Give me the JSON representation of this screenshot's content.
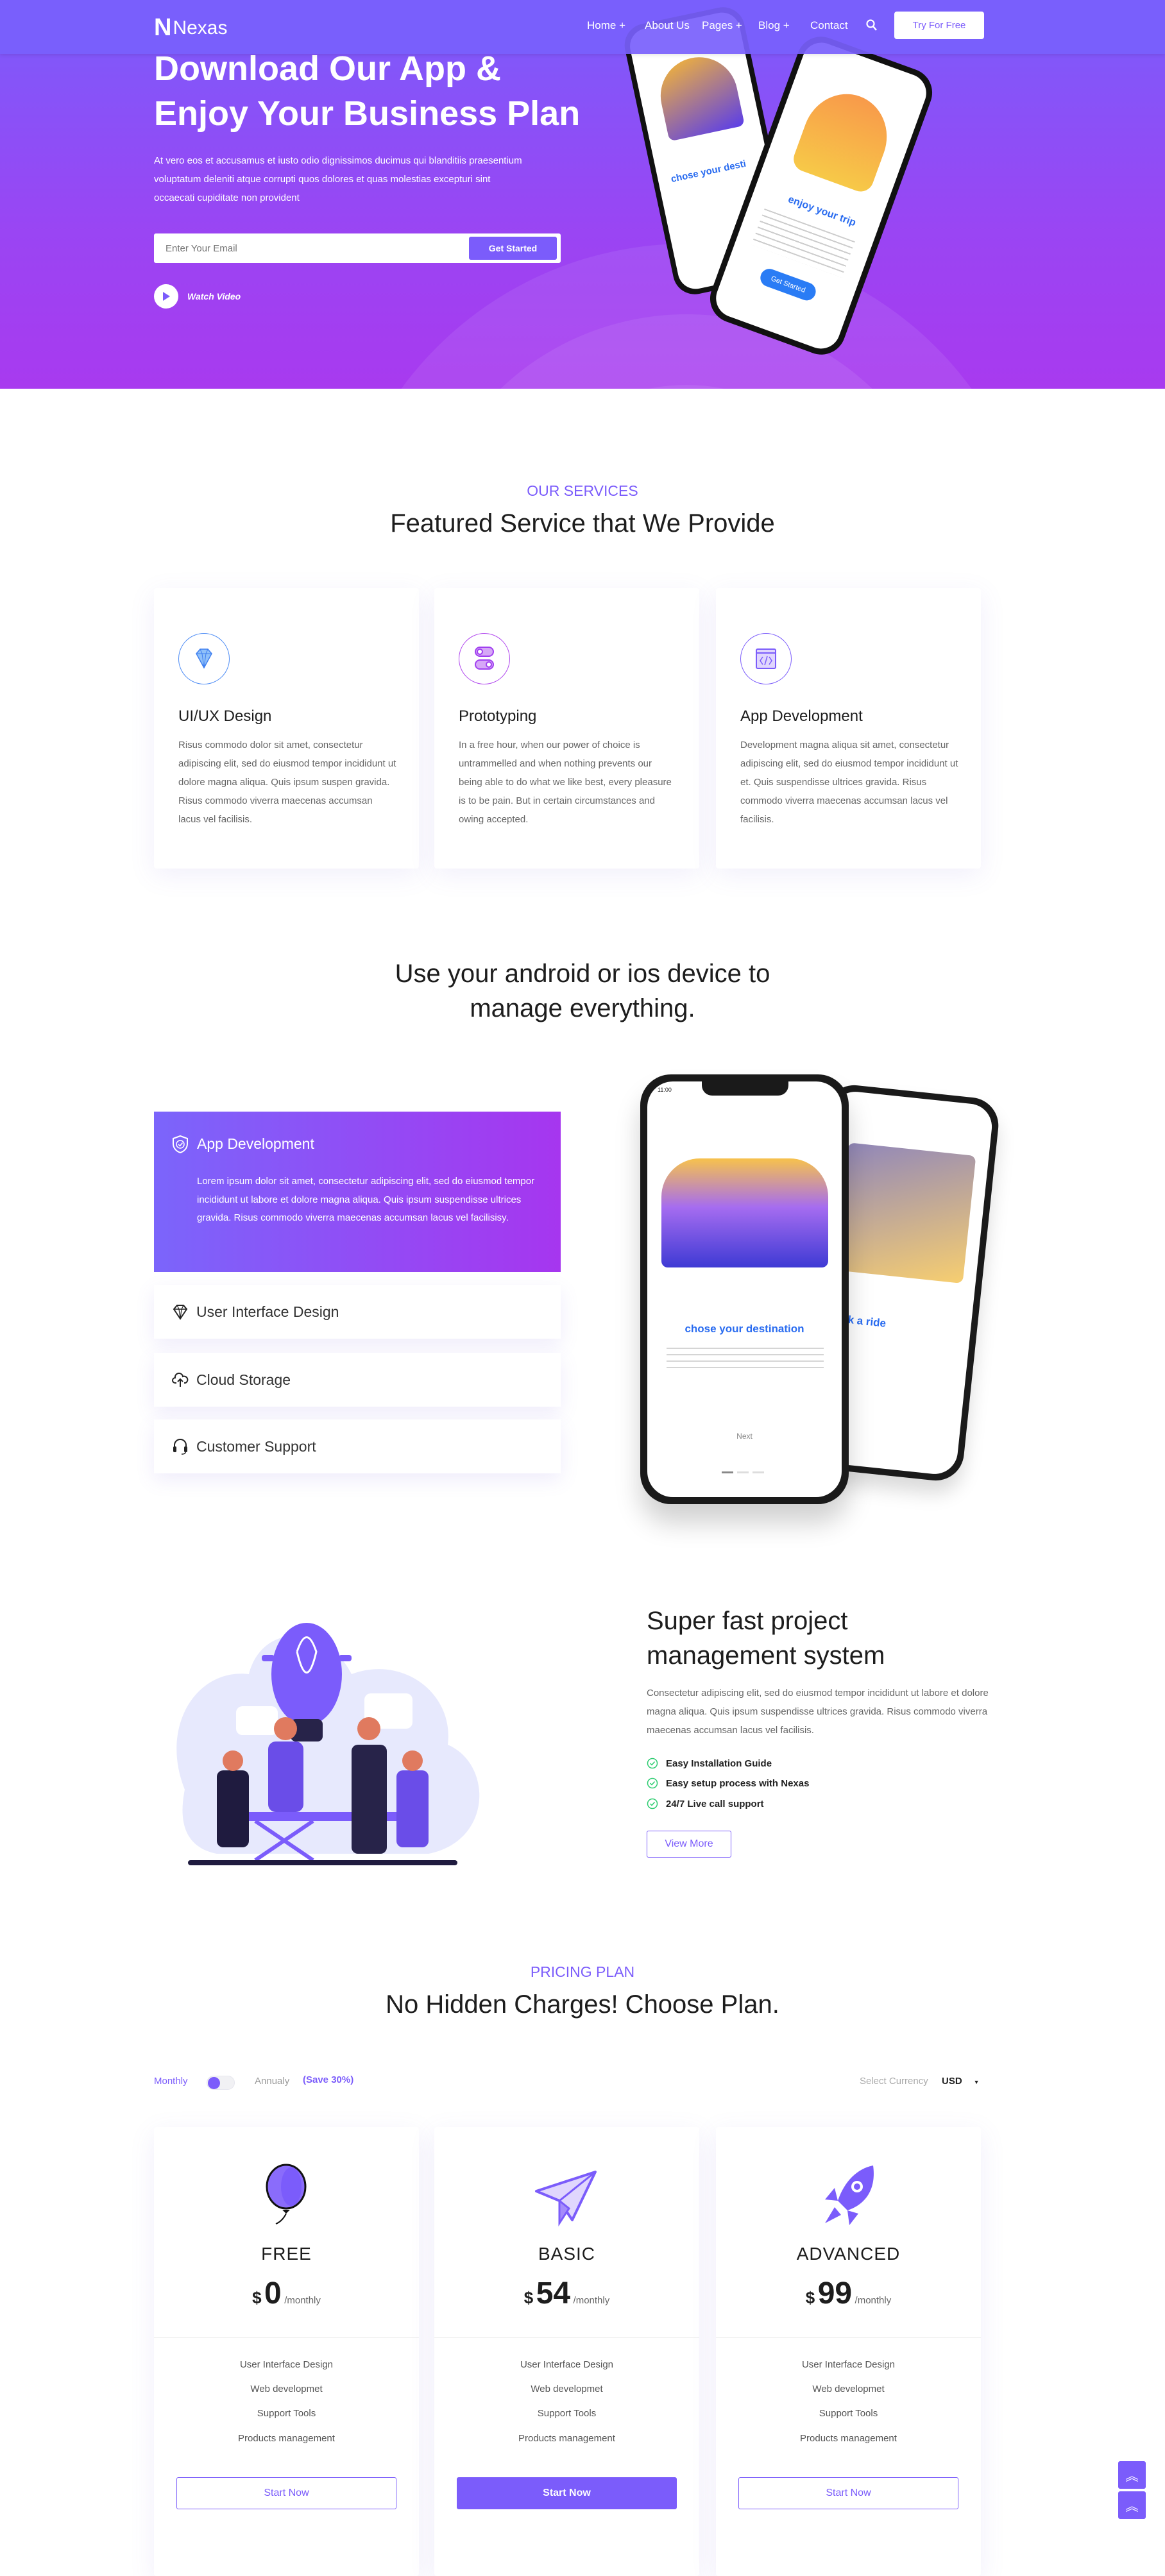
{
  "nav": {
    "brand": "Nexas",
    "brand_letter": "N",
    "items": [
      {
        "label": "Home +"
      },
      {
        "label": "About Us"
      },
      {
        "label": "Pages +"
      },
      {
        "label": "Blog +"
      },
      {
        "label": "Contact"
      }
    ],
    "search_icon": "search-icon",
    "cta": "Try For Free"
  },
  "hero": {
    "title_line1": "Download Our App &",
    "title_line2": "Enjoy Your Business Plan",
    "paragraph": "At vero eos et accusamus et iusto odio dignissimos ducimus qui blanditiis praesentium voluptatum deleniti atque corrupti quos dolores et quas molestias excepturi sint occaecati cupiditate non provident",
    "email_placeholder": "Enter Your Email",
    "submit": "Get Started",
    "watch_video": "Watch Video",
    "phone_back_text": "chose your desti",
    "phone_front_text": "enjoy your trip",
    "phone_front_button": "Get Started"
  },
  "services": {
    "eyebrow": "OUR SERVICES",
    "title": "Featured Service that We Provide",
    "cards": [
      {
        "icon": "diamond-icon",
        "title": "UI/UX Design",
        "text": "Risus commodo dolor sit amet, consectetur adipiscing elit, sed do eiusmod tempor incididunt ut dolore magna aliqua. Quis ipsum suspen gravida. Risus commodo viverra maecenas accumsan lacus vel facilisis."
      },
      {
        "icon": "toggle-switches-icon",
        "title": "Prototyping",
        "text": "In a free hour, when our power of choice is untrammelled and when nothing prevents our being able to do what we like best, every pleasure is to be pain. But in certain circumstances and owing accepted."
      },
      {
        "icon": "code-window-icon",
        "title": "App Development",
        "text": "Development magna aliqua sit amet, consectetur adipiscing elit, sed do eiusmod tempor incididunt ut et. Quis suspendisse ultrices gravida. Risus commodo viverra maecenas accumsan lacus vel facilisis."
      }
    ]
  },
  "devices": {
    "title_line1": "Use your android or ios device to",
    "title_line2": "manage everything.",
    "active_tab": {
      "icon": "shield-check-icon",
      "title": "App Development",
      "text": "Lorem ipsum dolor sit amet, consectetur adipiscing elit, sed do eiusmod tempor incididunt ut labore et dolore magna aliqua. Quis ipsum suspendisse ultrices gravida. Risus commodo viverra maecenas accumsan lacus vel facilisisy."
    },
    "tabs": [
      {
        "icon": "diamond-icon",
        "label": "User Interface Design"
      },
      {
        "icon": "cloud-upload-icon",
        "label": "Cloud Storage"
      },
      {
        "icon": "headset-icon",
        "label": "Customer Support"
      }
    ],
    "phone_front_text": "chose your destination",
    "phone_front_next": "Next",
    "phone_front_time": "11:00",
    "phone_back_text": "& book a ride"
  },
  "project": {
    "title_line1": "Super fast project",
    "title_line2": "management system",
    "paragraph": "Consectetur adipiscing elit, sed do eiusmod tempor incididunt ut labore et dolore magna aliqua. Quis ipsum suspendisse ultrices gravida. Risus commodo viverra maecenas accumsan lacus vel facilisis.",
    "checklist": [
      "Easy Installation Guide",
      "Easy setup process with Nexas",
      "24/7 Live call support"
    ],
    "button": "View More"
  },
  "pricing": {
    "eyebrow": "PRICING PLAN",
    "title": "No Hidden Charges! Choose Plan.",
    "billing": {
      "monthly": "Monthly",
      "annual": "Annualy",
      "save": "(Save 30%)",
      "selected": "monthly"
    },
    "currency_label": "Select Currency",
    "currency_value": "USD",
    "plans": [
      {
        "icon": "balloon-icon",
        "name": "FREE",
        "currency": "$",
        "price": "0",
        "period": "/monthly",
        "features": [
          "User Interface Design",
          "Web developmet",
          "Support Tools",
          "Products management"
        ],
        "button": "Start Now",
        "highlighted": false
      },
      {
        "icon": "paper-plane-icon",
        "name": "BASIC",
        "currency": "$",
        "price": "54",
        "period": "/monthly",
        "features": [
          "User Interface Design",
          "Web developmet",
          "Support Tools",
          "Products management"
        ],
        "button": "Start Now",
        "highlighted": true
      },
      {
        "icon": "rocket-icon",
        "name": "ADVANCED",
        "currency": "$",
        "price": "99",
        "period": "/monthly",
        "features": [
          "User Interface Design",
          "Web developmet",
          "Support Tools",
          "Products management"
        ],
        "button": "Start Now",
        "highlighted": false
      }
    ]
  },
  "colors": {
    "accent": "#7b5cfb",
    "hero_bottom": "#a83aef",
    "check": "#2ecc71"
  }
}
